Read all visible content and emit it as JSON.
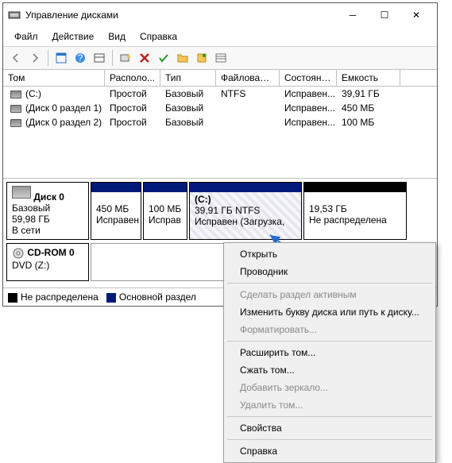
{
  "window": {
    "title": "Управление дисками"
  },
  "menu": {
    "file": "Файл",
    "action": "Действие",
    "view": "Вид",
    "help": "Справка"
  },
  "columns": {
    "vol": "Том",
    "layout": "Располо...",
    "type": "Тип",
    "fs": "Файловая с...",
    "state": "Состояние",
    "capacity": "Емкость"
  },
  "volumes": [
    {
      "name": "(C:)",
      "layout": "Простой",
      "type": "Базовый",
      "fs": "NTFS",
      "state": "Исправен...",
      "cap": "39,91 ГБ"
    },
    {
      "name": "(Диск 0 раздел 1)",
      "layout": "Простой",
      "type": "Базовый",
      "fs": "",
      "state": "Исправен...",
      "cap": "450 МБ"
    },
    {
      "name": "(Диск 0 раздел 2)",
      "layout": "Простой",
      "type": "Базовый",
      "fs": "",
      "state": "Исправен...",
      "cap": "100 МБ"
    }
  ],
  "disk0": {
    "title": "Диск 0",
    "type": "Базовый",
    "size": "59,98 ГБ",
    "status": "В сети",
    "p1": {
      "size": "450 МБ",
      "state": "Исправен ("
    },
    "p2": {
      "size": "100 МБ",
      "state": "Исправ"
    },
    "p3": {
      "label": "(C:)",
      "line2": "39,91 ГБ NTFS",
      "state": "Исправен (Загрузка,"
    },
    "p4": {
      "size": "19,53 ГБ",
      "state": "Не распределена"
    }
  },
  "cdrom": {
    "title": "CD-ROM 0",
    "sub": "DVD (Z:)"
  },
  "legend": {
    "unalloc": "Не распределена",
    "primary": "Основной раздел"
  },
  "ctx": {
    "open": "Открыть",
    "explorer": "Проводник",
    "active": "Сделать раздел активным",
    "letter": "Изменить букву диска или путь к диску...",
    "format": "Форматировать...",
    "extend": "Расширить том...",
    "shrink": "Сжать том...",
    "mirror": "Добавить зеркало...",
    "delete": "Удалить том...",
    "props": "Свойства",
    "help": "Справка"
  }
}
